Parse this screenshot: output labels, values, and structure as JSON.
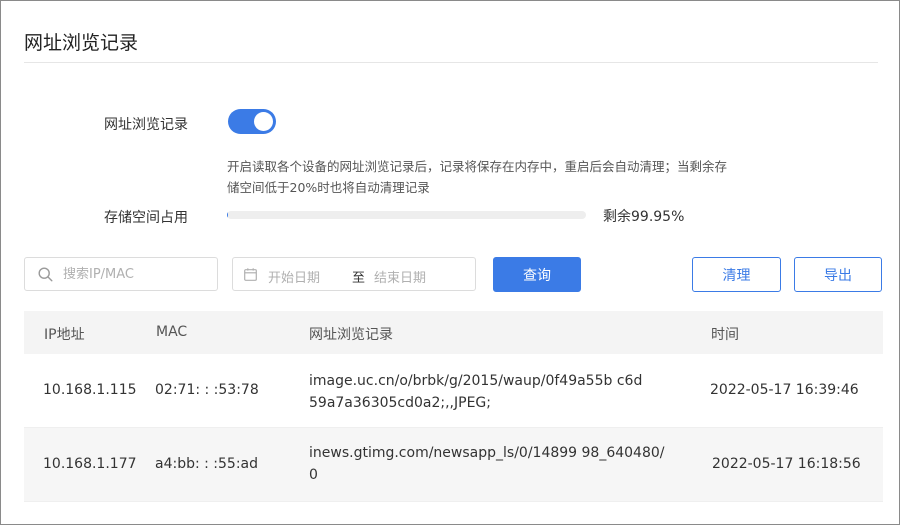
{
  "page": {
    "title": "网址浏览记录"
  },
  "settings": {
    "record_label": "网址浏览记录",
    "record_enabled": true,
    "description_lines": [
      "开启读取各个设备的网址浏览记录后，记录将保存在内存中，重启后会自动清理；当剩余存",
      "储空间低于20%时也将自动清理记录"
    ],
    "storage_label": "存储空间占用",
    "storage_used_percent": 0.05,
    "remaining_prefix": "剩余",
    "remaining_value": "99.95%"
  },
  "toolbar": {
    "search_placeholder": "搜索IP/MAC",
    "date_start_placeholder": "开始日期",
    "date_separator": "至",
    "date_end_placeholder": "结束日期",
    "query_label": "查询",
    "clear_label": "清理",
    "export_label": "导出"
  },
  "table": {
    "columns": {
      "ip": "IP地址",
      "mac": "MAC",
      "url": "网址浏览记录",
      "time": "时间"
    },
    "rows": [
      {
        "ip": "10.168.1.115",
        "mac": "02:71:  :  :53:78",
        "url_lines": [
          "image.uc.cn/o/brbk/g/2015/waup/0f49a55b        c6d",
          "59a7a36305cd0a2;,,JPEG;"
        ],
        "time": "2022-05-17 16:39:46"
      },
      {
        "ip": "10.168.1.177",
        "mac": "a4:bb:  :  :55:ad",
        "url_lines": [
          "inews.gtimg.com/newsapp_ls/0/14899       98_640480/",
          "0"
        ],
        "time": "2022-05-17 16:18:56"
      }
    ]
  },
  "colors": {
    "accent": "#3b7be6",
    "header_bg": "#f4f4f4",
    "row_alt_bg": "#f6f6f6"
  }
}
